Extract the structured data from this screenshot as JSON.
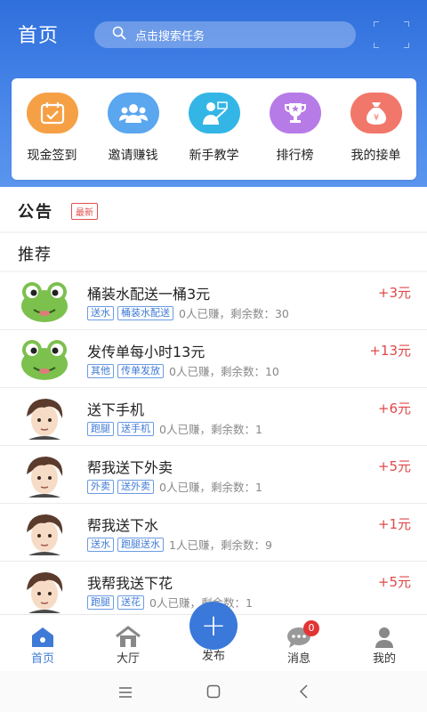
{
  "header": {
    "title": "首页",
    "search_placeholder": "点击搜索任务"
  },
  "menu": [
    {
      "label": "现金签到",
      "icon": "calendar-check-icon",
      "color": "#f6a046"
    },
    {
      "label": "邀请赚钱",
      "icon": "users-icon",
      "color": "#5aa6ef"
    },
    {
      "label": "新手教学",
      "icon": "teacher-icon",
      "color": "#33b6e6"
    },
    {
      "label": "排行榜",
      "icon": "trophy-icon",
      "color": "#b77be8"
    },
    {
      "label": "我的接单",
      "icon": "money-bag-icon",
      "color": "#f2776b"
    }
  ],
  "notice": {
    "title": "公告",
    "badge": "最新"
  },
  "recommend": {
    "title": "推荐"
  },
  "tasks": [
    {
      "title": "桶装水配送一桶3元",
      "tags": [
        "送水",
        "桶装水配送"
      ],
      "meta": "0人已赚，剩余数：30",
      "price": "+3元",
      "avatar": "frog"
    },
    {
      "title": "发传单每小时13元",
      "tags": [
        "其他",
        "传单发放"
      ],
      "meta": "0人已赚，剩余数：10",
      "price": "+13元",
      "avatar": "frog"
    },
    {
      "title": "送下手机",
      "tags": [
        "跑腿",
        "送手机"
      ],
      "meta": "0人已赚，剩余数：1",
      "price": "+6元",
      "avatar": "boy"
    },
    {
      "title": "帮我送下外卖",
      "tags": [
        "外卖",
        "送外卖"
      ],
      "meta": "0人已赚，剩余数：1",
      "price": "+5元",
      "avatar": "boy"
    },
    {
      "title": "帮我送下水",
      "tags": [
        "送水",
        "跑腿送水"
      ],
      "meta": "1人已赚，剩余数：9",
      "price": "+1元",
      "avatar": "boy"
    },
    {
      "title": "我帮我送下花",
      "tags": [
        "跑腿",
        "送花"
      ],
      "meta": "0人已赚，剩余数：1",
      "price": "+5元",
      "avatar": "boy"
    }
  ],
  "tabbar": {
    "home": "首页",
    "hall": "大厅",
    "publish": "发布",
    "messages": "消息",
    "messages_badge": "0",
    "mine": "我的"
  },
  "colors": {
    "primary": "#3a78da",
    "price": "#e04848",
    "tag": "#3f7ad6"
  }
}
